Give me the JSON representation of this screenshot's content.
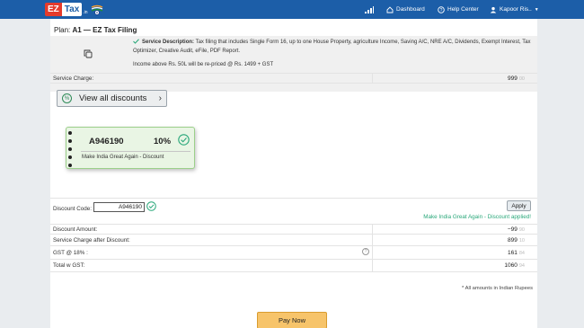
{
  "nav": {
    "logo_ez": "EZ",
    "logo_tax": "Tax",
    "logo_suffix": ".in",
    "dashboard": "Dashboard",
    "help_center": "Help Center",
    "user": "Kapoor Ris..",
    "icons": [
      "signal-icon",
      "home-icon",
      "help-icon",
      "user-icon",
      "caret-down-icon"
    ]
  },
  "plan": {
    "label": "Plan:",
    "name": "A1 — EZ Tax Filing",
    "desc_title": "Service Description:",
    "desc_body": "Tax filing that includes Single Form 16, up to one House Property, agriculture Income, Saving A/C, NRE A/C, Dividends, Exempt Interest, Tax Optimizer, Creative Audit, eFile, PDF Report.",
    "reprice_note": "Income above Rs. 50L will be re-priced @ Rs. 1499 + GST"
  },
  "service_charge": {
    "label": "Service Charge:",
    "value": "999",
    "decimals": "00"
  },
  "discounts": {
    "view_all_label": "View all discounts",
    "coupon": {
      "code": "A946190",
      "percent": "10%",
      "name": "Make India Great Again - Discount"
    }
  },
  "discount_code": {
    "label": "Discount Code:",
    "value": "A946190",
    "apply_label": "Apply",
    "applied_message": "Make India Great Again - Discount applied!"
  },
  "summary": [
    {
      "label": "Discount Amount:",
      "value": "−99",
      "decimals": "90"
    },
    {
      "label": "Service Charge after Discount:",
      "value": "899",
      "decimals": "10"
    },
    {
      "label": "GST @ 18% :",
      "value": "161",
      "decimals": "84"
    },
    {
      "label": "Total w GST:",
      "value": "1060",
      "decimals": "94"
    }
  ],
  "footnote": "* All amounts in Indian Rupees",
  "pay_label": "Pay Now",
  "colors": {
    "nav_bg": "#1c5ea8",
    "accent_green": "#2aa87a",
    "pay_button": "#f7c46a",
    "logo_red": "#e53b2c"
  }
}
